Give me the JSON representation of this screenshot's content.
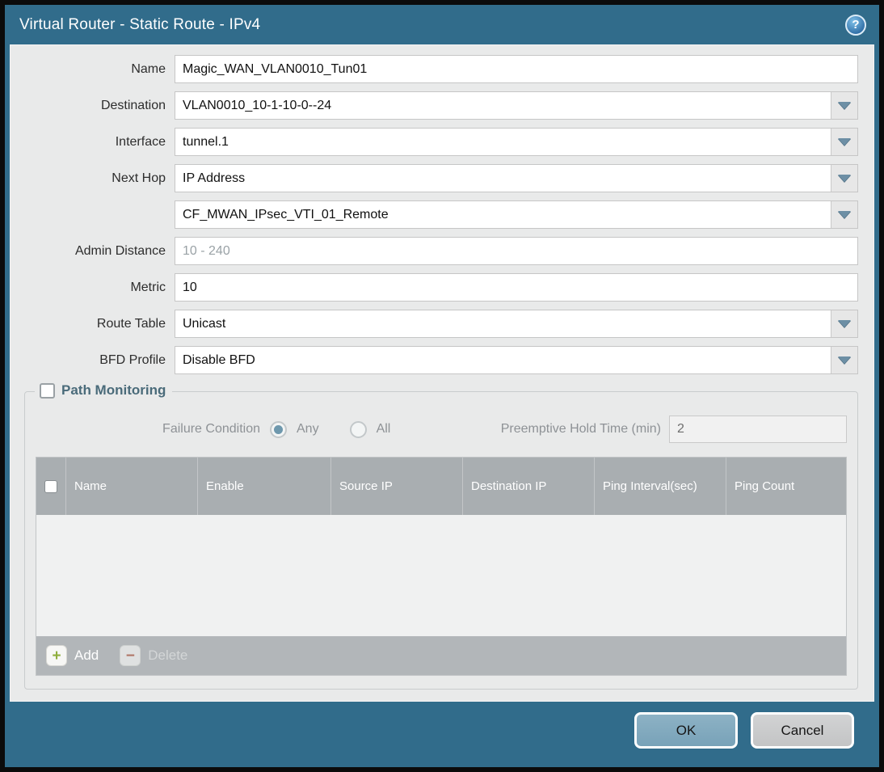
{
  "dialog": {
    "title": "Virtual Router - Static Route - IPv4",
    "help_glyph": "?"
  },
  "form": {
    "name": {
      "label": "Name",
      "value": "Magic_WAN_VLAN0010_Tun01"
    },
    "destination": {
      "label": "Destination",
      "value": "VLAN0010_10-1-10-0--24"
    },
    "interface": {
      "label": "Interface",
      "value": "tunnel.1"
    },
    "next_hop": {
      "label": "Next Hop",
      "value": "IP Address"
    },
    "next_hop_address": {
      "value": "CF_MWAN_IPsec_VTI_01_Remote"
    },
    "admin_distance": {
      "label": "Admin Distance",
      "placeholder": "10 - 240",
      "value": ""
    },
    "metric": {
      "label": "Metric",
      "value": "10"
    },
    "route_table": {
      "label": "Route Table",
      "value": "Unicast"
    },
    "bfd_profile": {
      "label": "BFD Profile",
      "value": "Disable BFD"
    }
  },
  "path_monitoring": {
    "title": "Path Monitoring",
    "checked": false,
    "failure_condition": {
      "label": "Failure Condition",
      "options": [
        {
          "label": "Any",
          "selected": true
        },
        {
          "label": "All",
          "selected": false
        }
      ]
    },
    "preemptive_hold_time": {
      "label": "Preemptive Hold Time (min)",
      "value": "2"
    },
    "table": {
      "columns": [
        "Name",
        "Enable",
        "Source IP",
        "Destination IP",
        "Ping Interval(sec)",
        "Ping Count"
      ],
      "rows": []
    },
    "toolbar": {
      "add_label": "Add",
      "delete_label": "Delete",
      "add_glyph": "+",
      "delete_glyph": "−"
    }
  },
  "footer": {
    "ok_label": "OK",
    "cancel_label": "Cancel"
  },
  "colors": {
    "frame_teal": "#316C8B",
    "content_bg": "#E9EAEA",
    "table_header_bg": "#A9AEB1",
    "table_footer_bg": "#B2B6B9",
    "ok_button_bg": "#7FA8BD",
    "cancel_button_bg": "#C9CACB",
    "radio_selected": "#6E98AD",
    "add_icon_green": "#8FAE3C",
    "delete_icon_red": "#B06A58"
  }
}
